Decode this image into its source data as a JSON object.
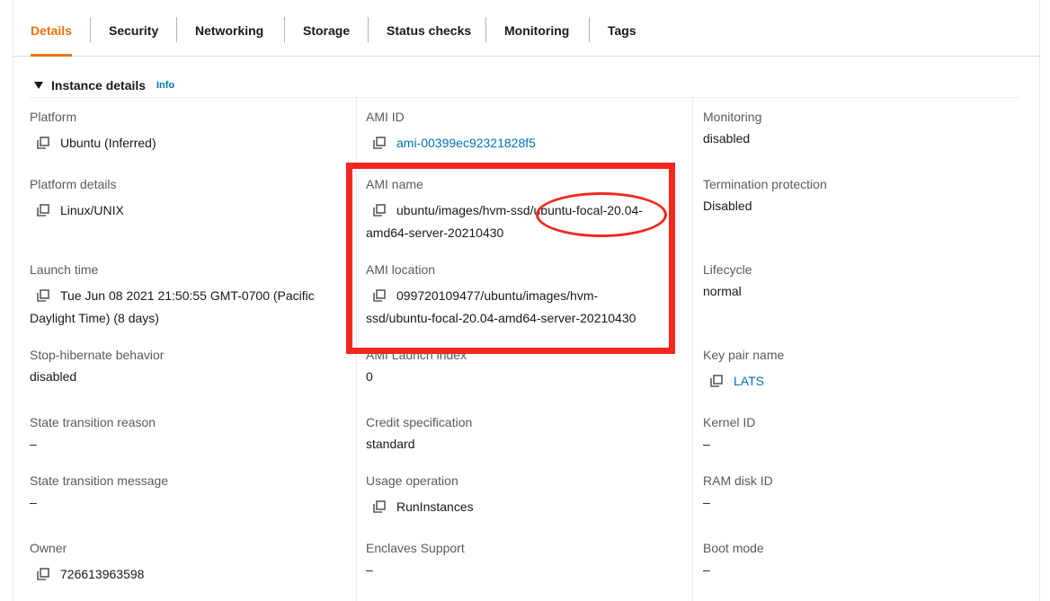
{
  "tabs": [
    {
      "label": "Details",
      "active": true
    },
    {
      "label": "Security"
    },
    {
      "label": "Networking"
    },
    {
      "label": "Storage"
    },
    {
      "label": "Status checks"
    },
    {
      "label": "Monitoring"
    },
    {
      "label": "Tags"
    }
  ],
  "section": {
    "title": "Instance details",
    "info": "Info"
  },
  "fields": {
    "platform": {
      "label": "Platform",
      "value": "Ubuntu (Inferred)"
    },
    "platform_details": {
      "label": "Platform details",
      "value": "Linux/UNIX"
    },
    "launch_time": {
      "label": "Launch time",
      "value_line1": "Tue Jun 08 2021 21:50:55 GMT-0700 (Pacific",
      "value_line2": "Daylight Time) (8 days)"
    },
    "stop_hibernate": {
      "label": "Stop-hibernate behavior",
      "value": "disabled"
    },
    "state_transition_reason": {
      "label": "State transition reason",
      "value": "–"
    },
    "state_transition_message": {
      "label": "State transition message",
      "value": "–"
    },
    "owner": {
      "label": "Owner",
      "value": "726613963598"
    },
    "ami_id": {
      "label": "AMI ID",
      "value": "ami-00399ec92321828f5"
    },
    "ami_name": {
      "label": "AMI name",
      "value_line1": "ubuntu/images/hvm-ssd/ubuntu-focal-20.04-",
      "value_line2": "amd64-server-20210430"
    },
    "ami_location": {
      "label": "AMI location",
      "value_line1": "099720109477/ubuntu/images/hvm-",
      "value_line2": "ssd/ubuntu-focal-20.04-amd64-server-20210430"
    },
    "ami_launch_index": {
      "label": "AMI Launch index",
      "value": "0"
    },
    "credit_specification": {
      "label": "Credit specification",
      "value": "standard"
    },
    "usage_operation": {
      "label": "Usage operation",
      "value": "RunInstances"
    },
    "enclaves_support": {
      "label": "Enclaves Support",
      "value": "–"
    },
    "monitoring": {
      "label": "Monitoring",
      "value": "disabled"
    },
    "termination_protection": {
      "label": "Termination protection",
      "value": "Disabled"
    },
    "lifecycle": {
      "label": "Lifecycle",
      "value": "normal"
    },
    "key_pair_name": {
      "label": "Key pair name",
      "value": "LATS"
    },
    "kernel_id": {
      "label": "Kernel ID",
      "value": "–"
    },
    "ram_disk_id": {
      "label": "RAM disk ID",
      "value": "–"
    },
    "boot_mode": {
      "label": "Boot mode",
      "value": "–"
    }
  },
  "colors": {
    "accent": "#ec7211",
    "link": "#0073bb",
    "annotation": "#f3271d"
  },
  "icons": {
    "copy": "copy-icon",
    "caret": "caret-down-icon"
  }
}
